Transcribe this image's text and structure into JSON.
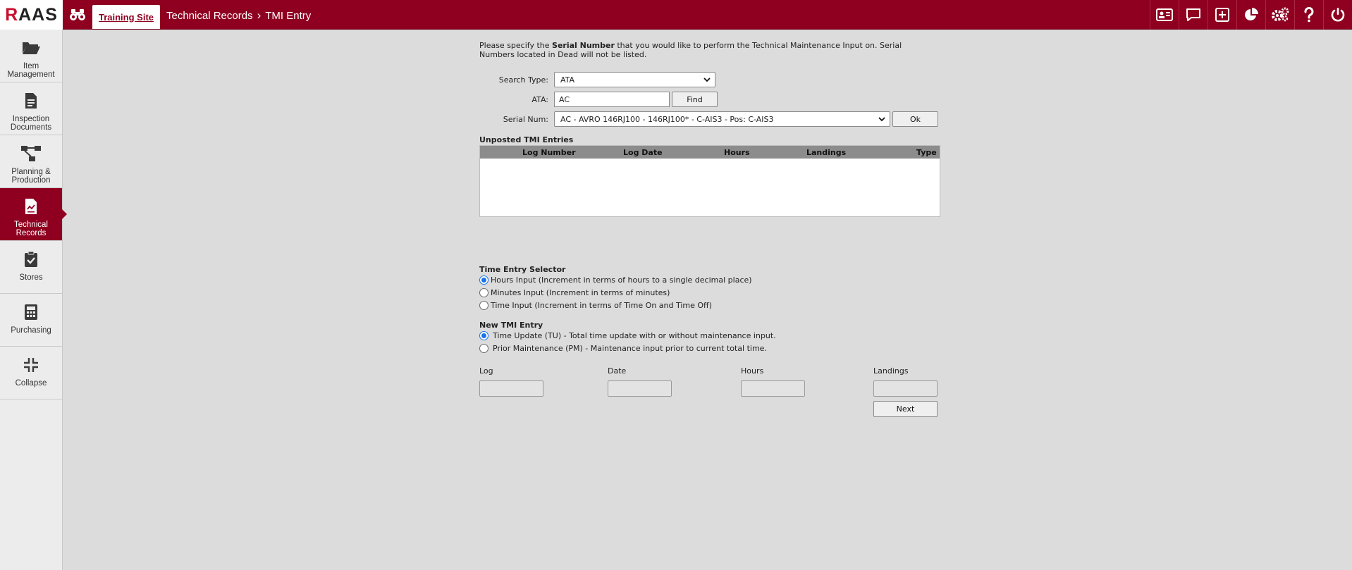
{
  "app": {
    "logo": "RAAS",
    "site_tab": "Training Site",
    "breadcrumb": {
      "section": "Technical Records",
      "separator": "›",
      "page": "TMI Entry"
    },
    "accent_color": "#8f0020"
  },
  "top_icons": [
    "id-card-icon",
    "chat-icon",
    "plus-box-icon",
    "pie-chart-icon",
    "gears-icon",
    "help-icon",
    "power-icon"
  ],
  "sidebar": {
    "items": [
      {
        "label": "Item Management",
        "icon": "folder-icon",
        "active": false
      },
      {
        "label": "Inspection Documents",
        "icon": "document-icon",
        "active": false
      },
      {
        "label": "Planning & Production",
        "icon": "flow-icon",
        "active": false
      },
      {
        "label": "Technical Records",
        "icon": "chart-document-icon",
        "active": true
      },
      {
        "label": "Stores",
        "icon": "clipboard-check-icon",
        "active": false
      },
      {
        "label": "Purchasing",
        "icon": "calculator-icon",
        "active": false
      },
      {
        "label": "Collapse",
        "icon": "collapse-icon",
        "active": false
      }
    ]
  },
  "intro": {
    "before": "Please specify the ",
    "bold": "Serial Number",
    "after": " that you would like to perform the Technical Maintenance Input on. Serial Numbers located in Dead will not be listed."
  },
  "form": {
    "search_type_label": "Search Type:",
    "search_type_value": "ATA",
    "ata_label": "ATA:",
    "ata_value": "AC",
    "find_button": "Find",
    "serial_label": "Serial Num:",
    "serial_value": "AC - AVRO 146RJ100 - 146RJ100* - C-AIS3 - Pos: C-AIS3",
    "ok_button": "Ok"
  },
  "unposted": {
    "title": "Unposted TMI Entries",
    "columns": [
      "Log Number",
      "Log Date",
      "Hours",
      "Landings",
      "Type"
    ],
    "rows": []
  },
  "time_entry": {
    "title": "Time Entry Selector",
    "options": [
      {
        "label": "Hours Input (Increment in terms of hours to a single decimal place)",
        "selected": true
      },
      {
        "label": "Minutes Input (Increment in terms of minutes)",
        "selected": false
      },
      {
        "label": "Time Input (Increment in terms of Time On and Time Off)",
        "selected": false
      }
    ]
  },
  "new_entry": {
    "title": "New TMI Entry",
    "options": [
      {
        "label": "Time Update (TU) - Total time update with or without maintenance input.",
        "selected": true
      },
      {
        "label": "Prior Maintenance (PM) - Maintenance input prior to current total time.",
        "selected": false
      }
    ]
  },
  "fields": {
    "log_label": "Log",
    "date_label": "Date",
    "hours_label": "Hours",
    "landings_label": "Landings",
    "next_button": "Next"
  }
}
